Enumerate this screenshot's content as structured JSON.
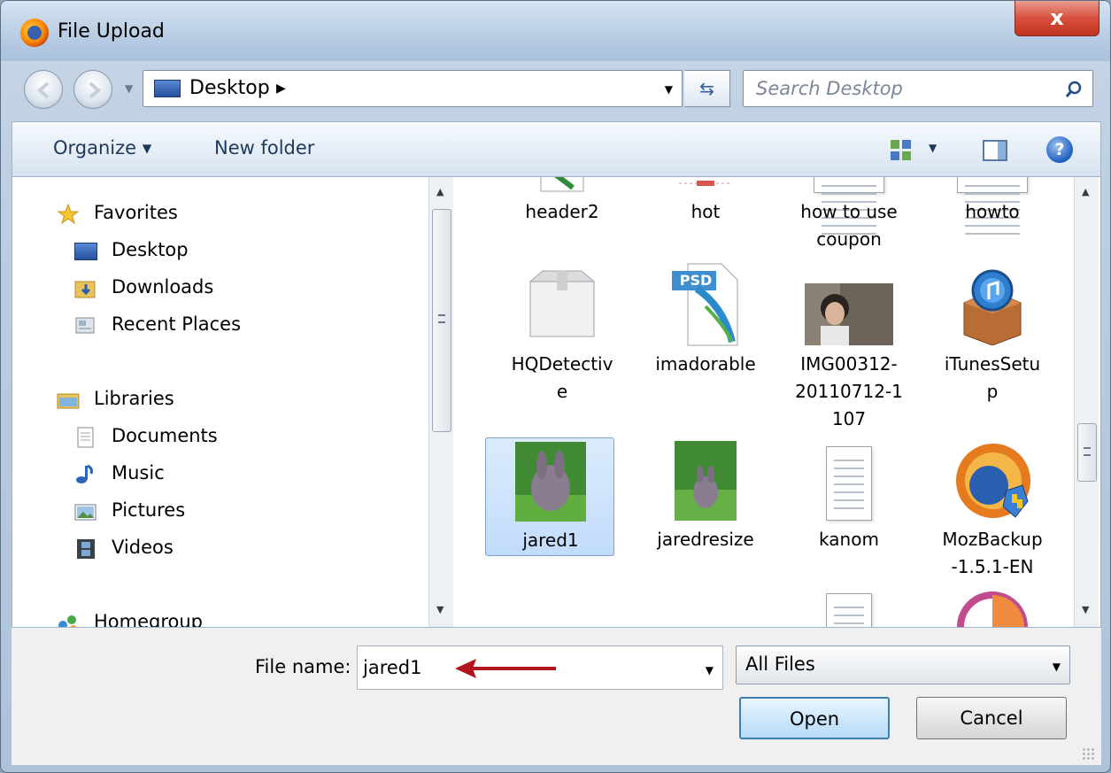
{
  "window": {
    "title": "File Upload",
    "close_label": "x"
  },
  "nav": {
    "address": "Desktop",
    "search_placeholder": "Search Desktop"
  },
  "toolbar": {
    "organize": "Organize ▾",
    "new_folder": "New folder",
    "help": "?"
  },
  "navpane": {
    "favorites": "Favorites",
    "desktop": "Desktop",
    "downloads": "Downloads",
    "recent_places": "Recent Places",
    "libraries": "Libraries",
    "documents": "Documents",
    "music": "Music",
    "pictures": "Pictures",
    "videos": "Videos",
    "homegroup": "Homegroup"
  },
  "files": {
    "header2": "header2",
    "hot": "hot",
    "how_to_use_1": "how to use",
    "how_to_use_2": "coupon",
    "howto": "howto",
    "hqdetective_1": "HQDetectiv",
    "hqdetective_2": "e",
    "imadorable": "imadorable",
    "img_1": "IMG00312-",
    "img_2": "20110712-1",
    "img_3": "107",
    "itunes_1": "iTunesSetu",
    "itunes_2": "p",
    "jared1": "jared1",
    "jaredresize": "jaredresize",
    "kanom": "kanom",
    "mozbackup_1": "MozBackup",
    "mozbackup_2": "-1.5.1-EN",
    "psd_badge": "PSD"
  },
  "bottom": {
    "file_name_label": "File name:",
    "file_name_value": "jared1",
    "filter": "All Files",
    "open": "Open",
    "cancel": "Cancel"
  },
  "colors": {
    "accent": "#3c7fb1",
    "selection": "#c1dcfb",
    "annotation_arrow": "#b0161c"
  }
}
